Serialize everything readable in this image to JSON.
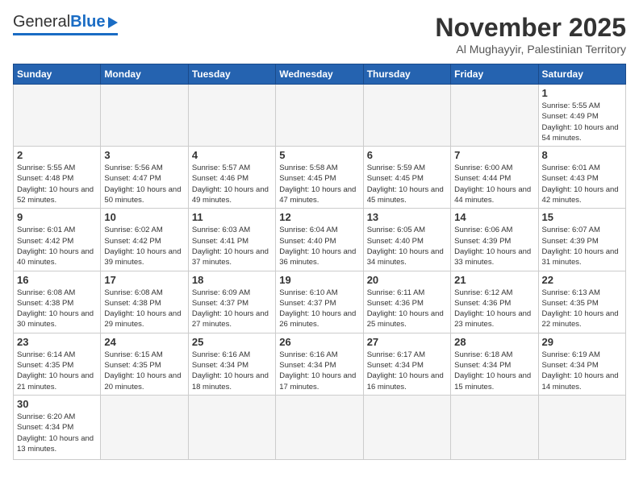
{
  "header": {
    "logo_general": "General",
    "logo_blue": "Blue",
    "month_title": "November 2025",
    "subtitle": "Al Mughayyir, Palestinian Territory"
  },
  "weekdays": [
    "Sunday",
    "Monday",
    "Tuesday",
    "Wednesday",
    "Thursday",
    "Friday",
    "Saturday"
  ],
  "days": [
    {
      "num": "",
      "info": ""
    },
    {
      "num": "",
      "info": ""
    },
    {
      "num": "",
      "info": ""
    },
    {
      "num": "",
      "info": ""
    },
    {
      "num": "",
      "info": ""
    },
    {
      "num": "",
      "info": ""
    },
    {
      "num": "1",
      "info": "Sunrise: 5:55 AM\nSunset: 4:49 PM\nDaylight: 10 hours\nand 54 minutes."
    },
    {
      "num": "2",
      "info": "Sunrise: 5:55 AM\nSunset: 4:48 PM\nDaylight: 10 hours\nand 52 minutes."
    },
    {
      "num": "3",
      "info": "Sunrise: 5:56 AM\nSunset: 4:47 PM\nDaylight: 10 hours\nand 50 minutes."
    },
    {
      "num": "4",
      "info": "Sunrise: 5:57 AM\nSunset: 4:46 PM\nDaylight: 10 hours\nand 49 minutes."
    },
    {
      "num": "5",
      "info": "Sunrise: 5:58 AM\nSunset: 4:45 PM\nDaylight: 10 hours\nand 47 minutes."
    },
    {
      "num": "6",
      "info": "Sunrise: 5:59 AM\nSunset: 4:45 PM\nDaylight: 10 hours\nand 45 minutes."
    },
    {
      "num": "7",
      "info": "Sunrise: 6:00 AM\nSunset: 4:44 PM\nDaylight: 10 hours\nand 44 minutes."
    },
    {
      "num": "8",
      "info": "Sunrise: 6:01 AM\nSunset: 4:43 PM\nDaylight: 10 hours\nand 42 minutes."
    },
    {
      "num": "9",
      "info": "Sunrise: 6:01 AM\nSunset: 4:42 PM\nDaylight: 10 hours\nand 40 minutes."
    },
    {
      "num": "10",
      "info": "Sunrise: 6:02 AM\nSunset: 4:42 PM\nDaylight: 10 hours\nand 39 minutes."
    },
    {
      "num": "11",
      "info": "Sunrise: 6:03 AM\nSunset: 4:41 PM\nDaylight: 10 hours\nand 37 minutes."
    },
    {
      "num": "12",
      "info": "Sunrise: 6:04 AM\nSunset: 4:40 PM\nDaylight: 10 hours\nand 36 minutes."
    },
    {
      "num": "13",
      "info": "Sunrise: 6:05 AM\nSunset: 4:40 PM\nDaylight: 10 hours\nand 34 minutes."
    },
    {
      "num": "14",
      "info": "Sunrise: 6:06 AM\nSunset: 4:39 PM\nDaylight: 10 hours\nand 33 minutes."
    },
    {
      "num": "15",
      "info": "Sunrise: 6:07 AM\nSunset: 4:39 PM\nDaylight: 10 hours\nand 31 minutes."
    },
    {
      "num": "16",
      "info": "Sunrise: 6:08 AM\nSunset: 4:38 PM\nDaylight: 10 hours\nand 30 minutes."
    },
    {
      "num": "17",
      "info": "Sunrise: 6:08 AM\nSunset: 4:38 PM\nDaylight: 10 hours\nand 29 minutes."
    },
    {
      "num": "18",
      "info": "Sunrise: 6:09 AM\nSunset: 4:37 PM\nDaylight: 10 hours\nand 27 minutes."
    },
    {
      "num": "19",
      "info": "Sunrise: 6:10 AM\nSunset: 4:37 PM\nDaylight: 10 hours\nand 26 minutes."
    },
    {
      "num": "20",
      "info": "Sunrise: 6:11 AM\nSunset: 4:36 PM\nDaylight: 10 hours\nand 25 minutes."
    },
    {
      "num": "21",
      "info": "Sunrise: 6:12 AM\nSunset: 4:36 PM\nDaylight: 10 hours\nand 23 minutes."
    },
    {
      "num": "22",
      "info": "Sunrise: 6:13 AM\nSunset: 4:35 PM\nDaylight: 10 hours\nand 22 minutes."
    },
    {
      "num": "23",
      "info": "Sunrise: 6:14 AM\nSunset: 4:35 PM\nDaylight: 10 hours\nand 21 minutes."
    },
    {
      "num": "24",
      "info": "Sunrise: 6:15 AM\nSunset: 4:35 PM\nDaylight: 10 hours\nand 20 minutes."
    },
    {
      "num": "25",
      "info": "Sunrise: 6:16 AM\nSunset: 4:34 PM\nDaylight: 10 hours\nand 18 minutes."
    },
    {
      "num": "26",
      "info": "Sunrise: 6:16 AM\nSunset: 4:34 PM\nDaylight: 10 hours\nand 17 minutes."
    },
    {
      "num": "27",
      "info": "Sunrise: 6:17 AM\nSunset: 4:34 PM\nDaylight: 10 hours\nand 16 minutes."
    },
    {
      "num": "28",
      "info": "Sunrise: 6:18 AM\nSunset: 4:34 PM\nDaylight: 10 hours\nand 15 minutes."
    },
    {
      "num": "29",
      "info": "Sunrise: 6:19 AM\nSunset: 4:34 PM\nDaylight: 10 hours\nand 14 minutes."
    },
    {
      "num": "30",
      "info": "Sunrise: 6:20 AM\nSunset: 4:34 PM\nDaylight: 10 hours\nand 13 minutes."
    },
    {
      "num": "",
      "info": ""
    },
    {
      "num": "",
      "info": ""
    },
    {
      "num": "",
      "info": ""
    },
    {
      "num": "",
      "info": ""
    },
    {
      "num": "",
      "info": ""
    },
    {
      "num": "",
      "info": ""
    }
  ]
}
